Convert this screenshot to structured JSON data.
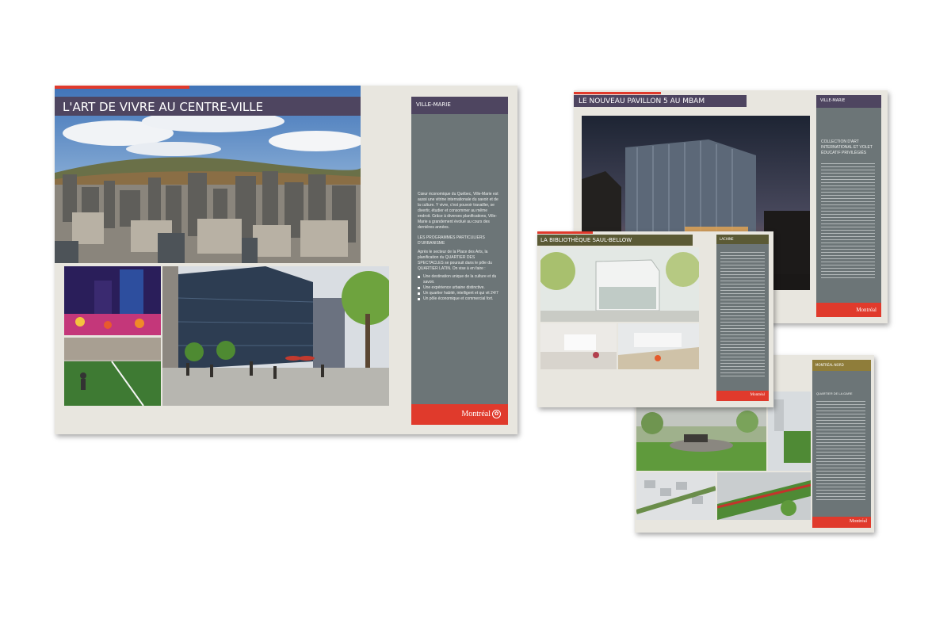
{
  "colors": {
    "accent_red": "#e03a2c",
    "banner_purple": "#4e4560",
    "banner_olive": "#5b5a35",
    "sidebar_gray": "#6c7577",
    "page_beige": "#e8e6df"
  },
  "page1": {
    "title": "L'ART DE VIVRE AU CENTRE-VILLE",
    "sidebar_header": "VILLE-MARIE",
    "intro": "Cœur économique du Québec, Ville-Marie est aussi une vitrine internationale du savoir et de la culture. Y vivre, c'est pouvoir travailler, se divertir, étudier et consommer au même endroit. Grâce à diverses planifications, Ville-Marie a grandement évolué au cours des dernières années.",
    "section_title": "LES PROGRAMMES PARTICULIERS D'URBANISME",
    "section_text": "Après le secteur de la Place des Arts, la planification du QUARTIER DES SPECTACLES se poursuit dans le pôle du QUARTIER LATIN. On vise à en faire :",
    "bullets": [
      "Une destination unique de la culture et du savoir.",
      "Une expérience urbaine distinctive.",
      "Un quartier habité, intelligent et qui vit 24/7",
      "Un pôle économique et commercial fort."
    ],
    "logo": "Montréal"
  },
  "page2": {
    "title": "LE NOUVEAU PAVILLON 5 AU MBAM",
    "sidebar_header": "VILLE-MARIE",
    "heading": "COLLECTION D'ART INTERNATIONAL ET VOLET ÉDUCATIF PRIVILÉGIÉS",
    "logo": "Montréal"
  },
  "page3": {
    "title": "LA BIBLIOTHÈQUE SAUL-BELLOW",
    "sidebar_header": "LACHINE",
    "logo": "Montréal"
  },
  "page4": {
    "sidebar_header": "MONTRÉAL-NORD",
    "heading": "QUARTIER DE LA GARE",
    "logo": "Montréal"
  }
}
